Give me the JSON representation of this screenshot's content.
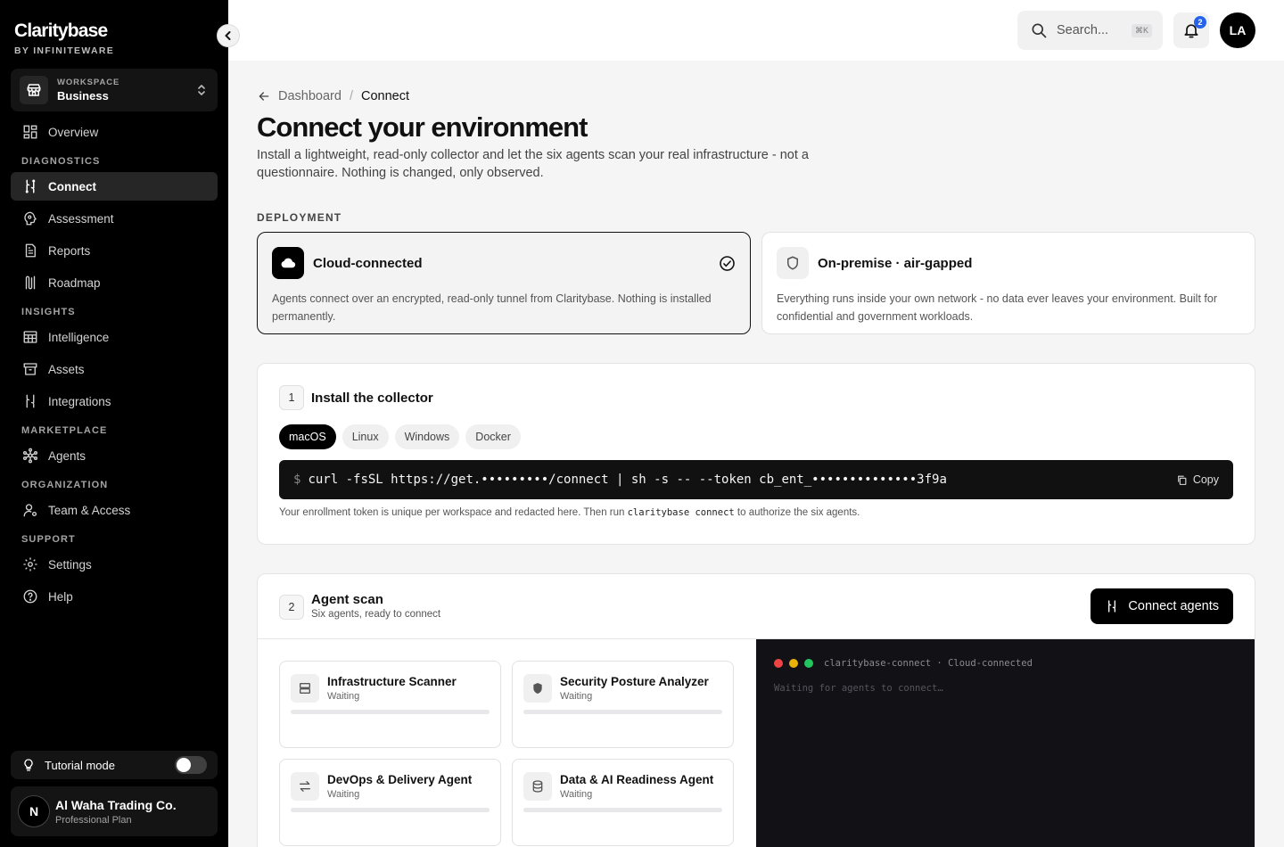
{
  "brand": {
    "name": "Claritybase",
    "sub": "BY INFINITEWARE"
  },
  "workspace": {
    "label": "WORKSPACE",
    "name": "Business"
  },
  "nav": {
    "overview": "Overview",
    "sections": {
      "diagnostics": "DIAGNOSTICS",
      "insights": "INSIGHTS",
      "marketplace": "MARKETPLACE",
      "organization": "ORGANIZATION",
      "support": "SUPPORT"
    },
    "connect": "Connect",
    "assessment": "Assessment",
    "reports": "Reports",
    "roadmap": "Roadmap",
    "intelligence": "Intelligence",
    "assets": "Assets",
    "integrations": "Integrations",
    "agents": "Agents",
    "team": "Team & Access",
    "settings": "Settings",
    "help": "Help"
  },
  "tutorial": {
    "label": "Tutorial mode"
  },
  "org": {
    "initial": "N",
    "name": "Al Waha Trading Co.",
    "plan": "Professional Plan"
  },
  "header": {
    "search_placeholder": "Search...",
    "shortcut": "⌘K",
    "notifications": "2",
    "avatar": "LA"
  },
  "breadcrumb": {
    "parent": "Dashboard",
    "sep": "/",
    "current": "Connect"
  },
  "page": {
    "title": "Connect your environment",
    "description": "Install a lightweight, read-only collector and let the six agents scan your real infrastructure - not a questionnaire. Nothing is changed, only observed."
  },
  "deployment": {
    "label": "DEPLOYMENT",
    "cloud": {
      "title": "Cloud-connected",
      "text": "Agents connect over an encrypted, read-only tunnel from Claritybase. Nothing is installed permanently."
    },
    "onprem": {
      "title": "On-premise · air-gapped",
      "text": "Everything runs inside your own network - no data ever leaves your environment. Built for confidential and government workloads."
    }
  },
  "step1": {
    "num": "1",
    "title": "Install the collector",
    "tabs": [
      "macOS",
      "Linux",
      "Windows",
      "Docker"
    ],
    "prompt": "$",
    "command": "curl -fsSL https://get.•••••••••/connect | sh -s -- --token cb_ent_••••••••••••••3f9a",
    "copy": "Copy",
    "hint_pre": "Your enrollment token is unique per workspace and redacted here. Then run ",
    "hint_code": "claritybase connect",
    "hint_post": " to authorize the six agents."
  },
  "step2": {
    "num": "2",
    "title": "Agent scan",
    "subtitle": "Six agents, ready to connect",
    "cta": "Connect agents",
    "agents": [
      {
        "name": "Infrastructure Scanner",
        "status": "Waiting",
        "progress": 0
      },
      {
        "name": "Security Posture Analyzer",
        "status": "Waiting",
        "progress": 0
      },
      {
        "name": "DevOps & Delivery Agent",
        "status": "Waiting",
        "progress": 0
      },
      {
        "name": "Data & AI Readiness Agent",
        "status": "Waiting",
        "progress": 0
      }
    ],
    "terminal": {
      "title": "claritybase-connect · Cloud-connected",
      "line": "Waiting for agents to connect…"
    }
  },
  "colors": {
    "accent": "#000000",
    "badge": "#2563eb",
    "dot_red": "#ef4444",
    "dot_yellow": "#eab308",
    "dot_green": "#22c55e"
  }
}
